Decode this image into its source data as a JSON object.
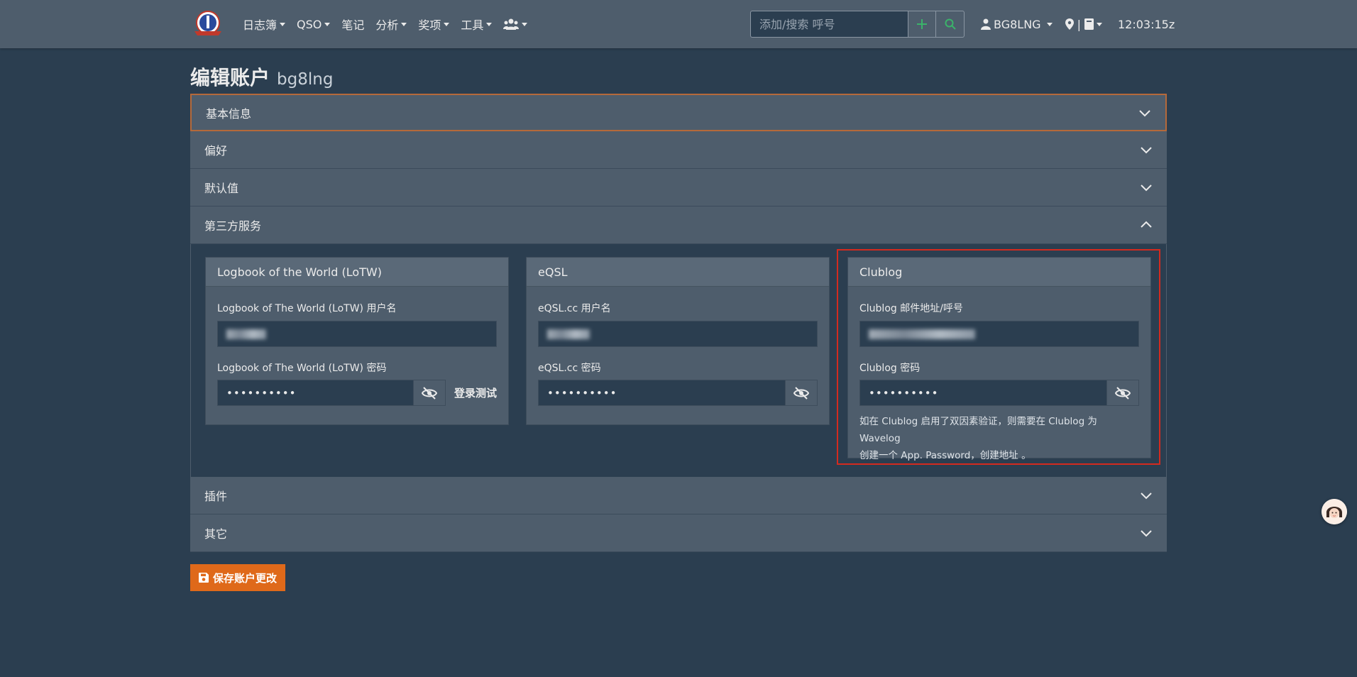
{
  "navbar": {
    "menu": [
      {
        "label": "日志簿",
        "dropdown": true
      },
      {
        "label": "QSO",
        "dropdown": true
      },
      {
        "label": "笔记",
        "dropdown": false
      },
      {
        "label": "分析",
        "dropdown": true
      },
      {
        "label": "奖项",
        "dropdown": true
      },
      {
        "label": "工具",
        "dropdown": true
      }
    ],
    "community_icon": "users-icon",
    "search_placeholder": "添加/搜索 呼号",
    "user": "BG8LNG",
    "time": "12:03:15z"
  },
  "page": {
    "title": "编辑账户",
    "username": "bg8lng"
  },
  "accordion": {
    "basic": "基本信息",
    "prefs": "偏好",
    "defaults": "默认值",
    "third_party": "第三方服务",
    "plugins": "插件",
    "other": "其它"
  },
  "lotw": {
    "header": "Logbook of the World (LoTW)",
    "user_label": "Logbook of The World (LoTW) 用户名",
    "pass_label": "Logbook of The World (LoTW) 密码",
    "password": "••••••••••",
    "test_button": "登录测试"
  },
  "eqsl": {
    "header": "eQSL",
    "user_label": "eQSL.cc 用户名",
    "pass_label": "eQSL.cc 密码",
    "password": "••••••••••"
  },
  "clublog": {
    "header": "Clublog",
    "user_label": "Clublog 邮件地址/呼号",
    "pass_label": "Clublog 密码",
    "password": "••••••••••",
    "help_line1": "如在 Clublog 启用了双因素验证，则需要在 Clublog 为 Wavelog",
    "help_line2": "创建一个 App. Password，创建地址 。"
  },
  "save_button": "保存账户更改",
  "colors": {
    "navbar": "#4e5d6c",
    "background": "#2b3e50",
    "accent": "#df691a",
    "highlight": "#d42a1f"
  }
}
